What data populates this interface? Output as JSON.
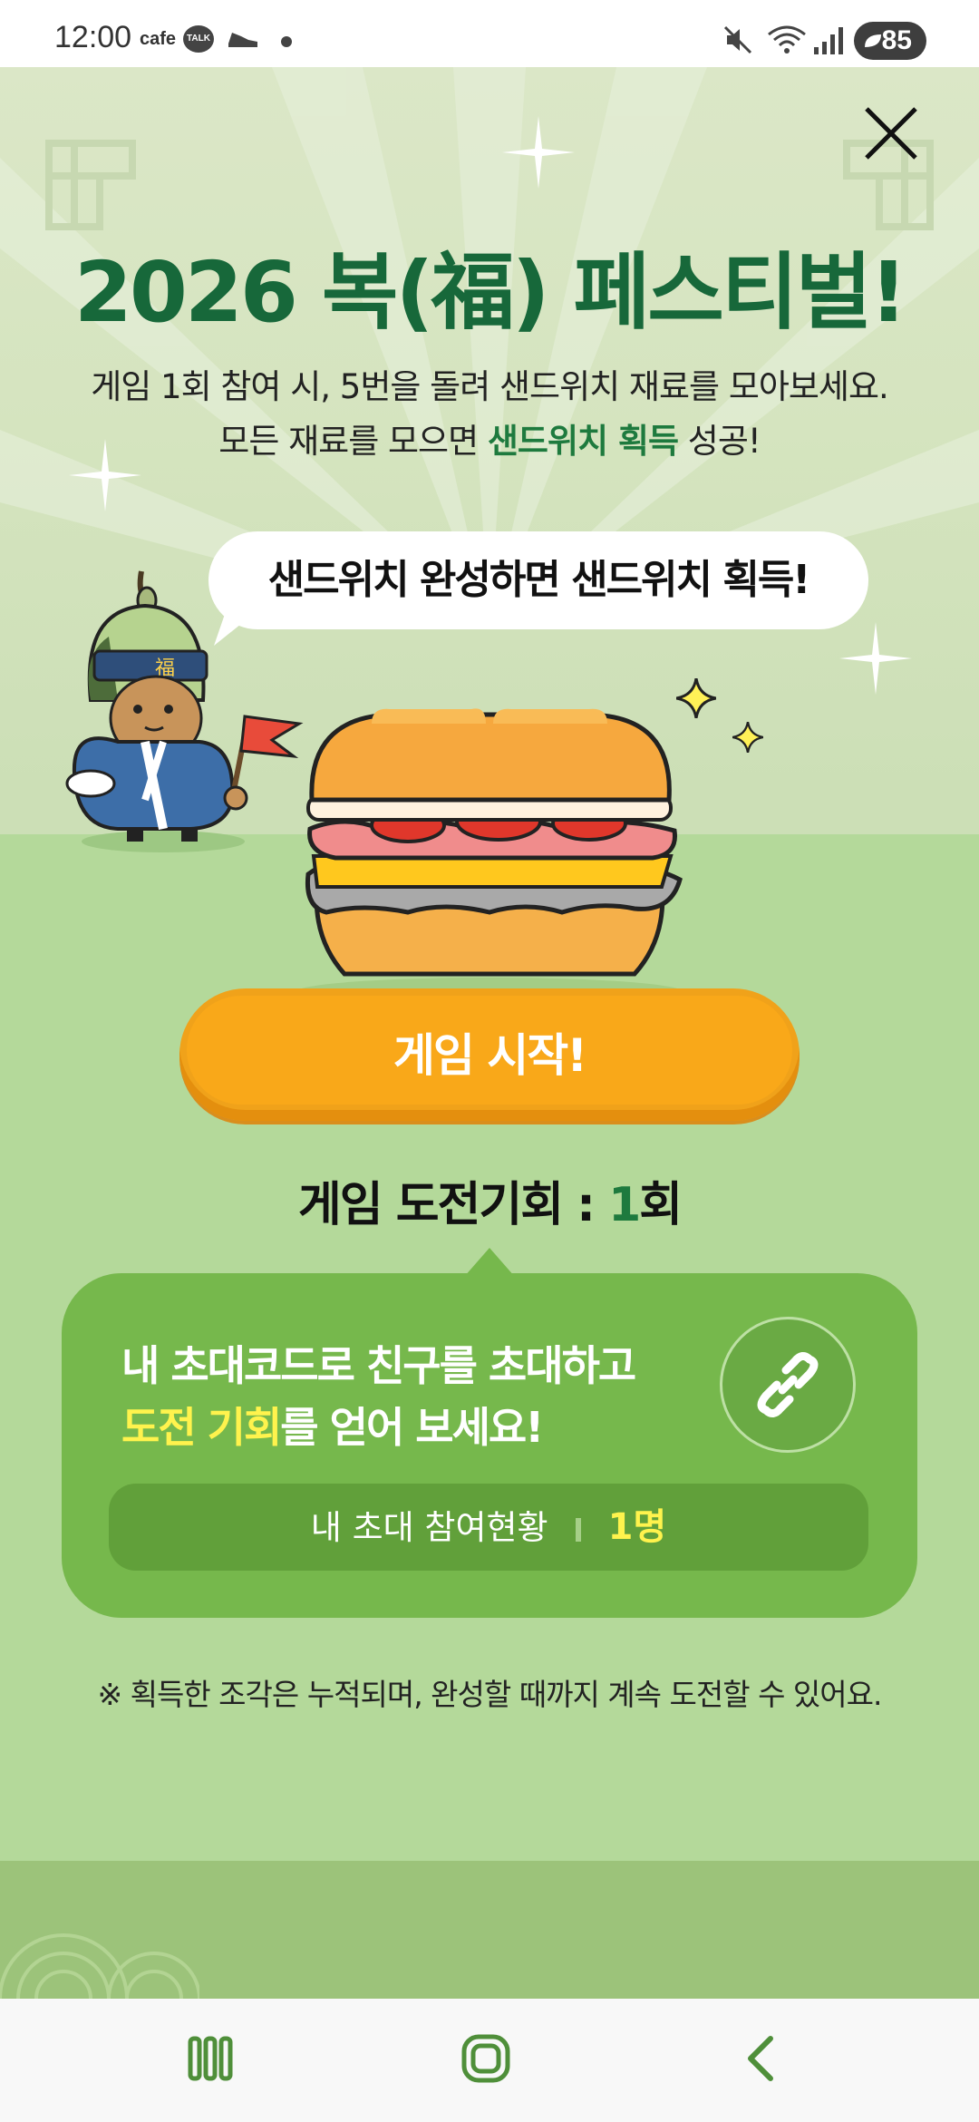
{
  "status_bar": {
    "time": "12:00",
    "app1": "cafe",
    "app2": "TALK",
    "battery": "85"
  },
  "header": {
    "title": "2026 복(福) 페스티벌!",
    "desc_line1": "게임 1회 참여 시, 5번을 돌려 샌드위치 재료를 모아보세요.",
    "desc_line2_prefix": "모든 재료를 모으면 ",
    "desc_line2_highlight": "샌드위치 획득",
    "desc_line2_suffix": " 성공!"
  },
  "bubble": {
    "text": "샌드위치 완성하면 샌드위치 획득!"
  },
  "mascot": {
    "headband_char": "福"
  },
  "start_button": {
    "label": "게임 시작!"
  },
  "chance": {
    "label": "게임 도전기회 : ",
    "count": "1",
    "unit": "회"
  },
  "invite": {
    "line1": "내 초대코드로 친구를 초대하고",
    "line2_highlight": "도전 기회",
    "line2_suffix": "를 얻어 보세요!",
    "status_label": "내 초대 참여현황",
    "status_count": "1명"
  },
  "notice": {
    "text": "※ 획득한 조각은 누적되며, 완성할 때까지 계속 도전할 수 있어요."
  },
  "colors": {
    "title_green": "#17683a",
    "highlight_green": "#1e7a3e",
    "card_green": "#76b84c",
    "button_orange": "#f9a819",
    "accent_yellow": "#fff34d"
  },
  "icons": {
    "close": "close-icon",
    "link": "link-icon",
    "recents": "recents-icon",
    "home": "home-icon",
    "back": "back-icon"
  }
}
